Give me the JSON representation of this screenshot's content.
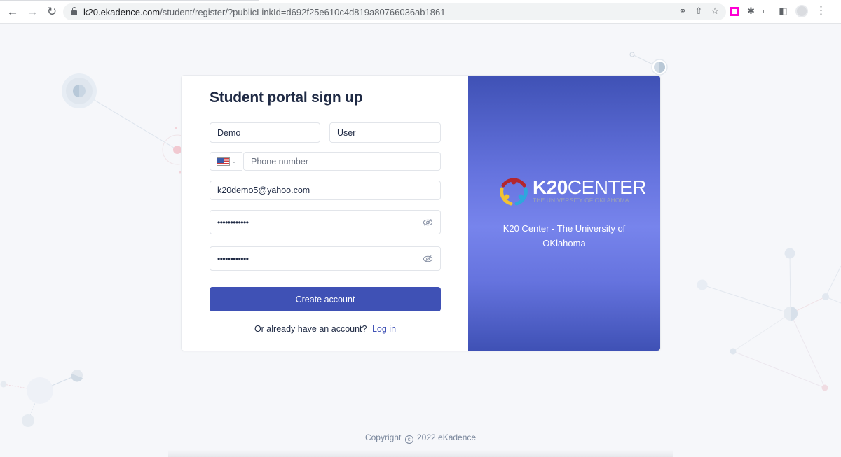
{
  "browser": {
    "url_host": "k20.ekadence.com",
    "url_path": "/student/register/?publicLinkId=d692f25e610c4d819a80766036ab1861",
    "nav_icons": [
      "back-arrow-icon",
      "forward-arrow-icon",
      "reload-icon"
    ],
    "omnibox_icons": [
      "key-icon",
      "share-icon",
      "star-icon"
    ],
    "toolbar_icons": [
      "extension-pink-icon",
      "puzzle-icon",
      "cast-icon",
      "side-panel-icon",
      "profile-avatar",
      "more-menu-icon"
    ]
  },
  "form": {
    "title": "Student portal sign up",
    "first_name": "Demo",
    "last_name": "User",
    "country_flag": "us-flag-icon",
    "phone_placeholder": "Phone number",
    "email": "k20demo5@yahoo.com",
    "password_mask": "••••••••••••",
    "confirm_password_mask": "••••••••••••",
    "create_button": "Create account",
    "login_prompt": "Or already have an account?",
    "login_link": "Log in"
  },
  "brand": {
    "logo_bold": "K20",
    "logo_light": "CENTER",
    "logo_sub": "THE UNIVERSITY OF OKLAHOMA",
    "caption": "K20 Center - The University of OKlahoma"
  },
  "footer": {
    "copyright_prefix": "Copyright",
    "copyright_symbol": "c",
    "copyright_suffix": "2022 eKadence"
  },
  "colors": {
    "primary": "#3f51b5",
    "brand_gradient_mid": "#7784ec",
    "title": "#1f2a44",
    "page_bg": "#f6f7fa"
  }
}
